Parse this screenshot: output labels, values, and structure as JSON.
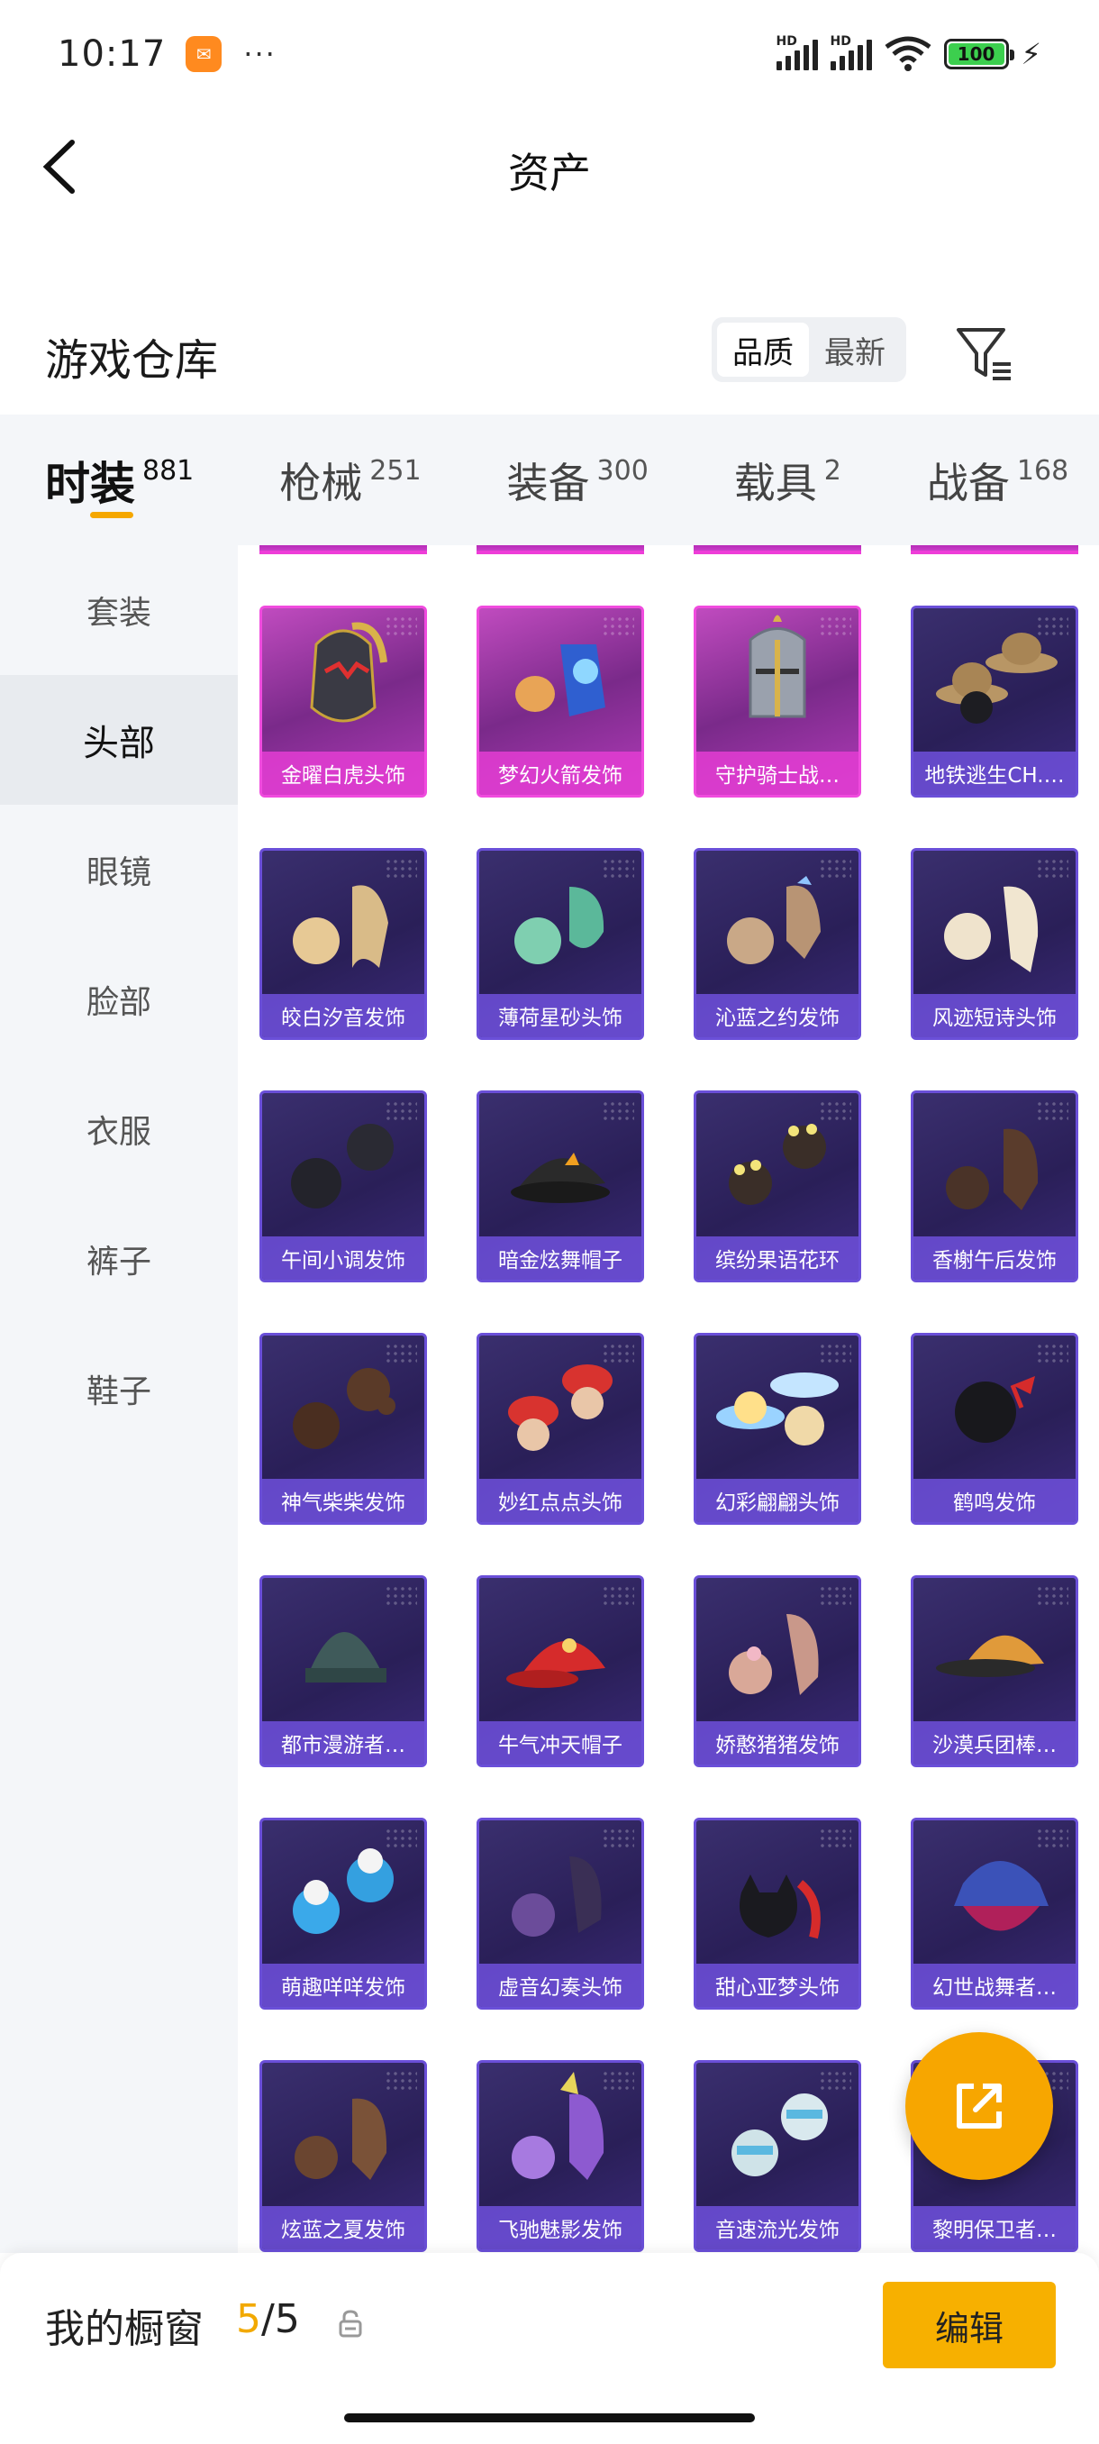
{
  "status_bar": {
    "time": "10:17",
    "dots": "···",
    "network_label": "HD",
    "battery": "100",
    "icons": [
      "app-notification-icon",
      "signal-icon",
      "wifi-icon",
      "battery-icon",
      "charging-icon"
    ]
  },
  "header": {
    "title": "资产",
    "back_icon": "back-arrow-icon"
  },
  "section": {
    "title": "游戏仓库",
    "sort_options": [
      "品质",
      "最新"
    ],
    "sort_selected": "品质",
    "filter_icon": "filter-icon"
  },
  "tabs": [
    {
      "label": "时装",
      "count": "881",
      "active": true
    },
    {
      "label": "枪械",
      "count": "251",
      "active": false
    },
    {
      "label": "装备",
      "count": "300",
      "active": false
    },
    {
      "label": "载具",
      "count": "2",
      "active": false
    },
    {
      "label": "战备",
      "count": "168",
      "active": false
    }
  ],
  "side_menu": [
    {
      "label": "套装",
      "active": false
    },
    {
      "label": "头部",
      "active": true
    },
    {
      "label": "眼镜",
      "active": false
    },
    {
      "label": "脸部",
      "active": false
    },
    {
      "label": "衣服",
      "active": false
    },
    {
      "label": "裤子",
      "active": false
    },
    {
      "label": "鞋子",
      "active": false
    }
  ],
  "items": [
    {
      "name": "金曜白虎头饰",
      "rarity": "legendary",
      "art": "helmet-tiger"
    },
    {
      "name": "梦幻火箭发饰",
      "rarity": "legendary",
      "art": "rocket"
    },
    {
      "name": "守护骑士战…",
      "rarity": "legendary",
      "art": "knight-helmet"
    },
    {
      "name": "地铁逃生CH.…",
      "rarity": "epic",
      "art": "hat-brown"
    },
    {
      "name": "皎白汐音发饰",
      "rarity": "epic",
      "art": "hair-blonde"
    },
    {
      "name": "薄荷星砂头饰",
      "rarity": "epic",
      "art": "hair-mint"
    },
    {
      "name": "沁蓝之约发饰",
      "rarity": "epic",
      "art": "hair-light"
    },
    {
      "name": "风迹短诗头饰",
      "rarity": "epic",
      "art": "hair-cream"
    },
    {
      "name": "午间小调发饰",
      "rarity": "epic",
      "art": "hair-dark"
    },
    {
      "name": "暗金炫舞帽子",
      "rarity": "epic",
      "art": "cap-black"
    },
    {
      "name": "缤纷果语花环",
      "rarity": "epic",
      "art": "flower-crown"
    },
    {
      "name": "香榭午后发饰",
      "rarity": "epic",
      "art": "hair-brown"
    },
    {
      "name": "神气柴柴发饰",
      "rarity": "epic",
      "art": "hair-bun"
    },
    {
      "name": "妙红点点头饰",
      "rarity": "epic",
      "art": "mushroom"
    },
    {
      "name": "幻彩翩翩头饰",
      "rarity": "epic",
      "art": "hat-pastel"
    },
    {
      "name": "鹤鸣发饰",
      "rarity": "epic",
      "art": "hair-ribbon"
    },
    {
      "name": "都市漫游者…",
      "rarity": "epic",
      "art": "beanie"
    },
    {
      "name": "牛气冲天帽子",
      "rarity": "epic",
      "art": "cap-red"
    },
    {
      "name": "娇憨猪猪发饰",
      "rarity": "epic",
      "art": "pig-hair"
    },
    {
      "name": "沙漠兵团棒…",
      "rarity": "epic",
      "art": "cap-desert"
    },
    {
      "name": "萌趣咩咩发饰",
      "rarity": "epic",
      "art": "hair-sheep"
    },
    {
      "name": "虚音幻奏头饰",
      "rarity": "epic",
      "art": "hair-purple"
    },
    {
      "name": "甜心亚梦头饰",
      "rarity": "epic",
      "art": "cat-hair"
    },
    {
      "name": "幻世战舞者…",
      "rarity": "epic",
      "art": "bucket-hat"
    },
    {
      "name": "炫蓝之夏发饰",
      "rarity": "epic",
      "art": "hair-auburn"
    },
    {
      "name": "飞驰魅影发饰",
      "rarity": "epic",
      "art": "hair-violet"
    },
    {
      "name": "音速流光发饰",
      "rarity": "epic",
      "art": "helmet-silver"
    },
    {
      "name": "黎明保卫者…",
      "rarity": "epic",
      "art": "hair-green"
    }
  ],
  "fab": {
    "icon": "share-external-icon"
  },
  "bottom_bar": {
    "showcase_label": "我的橱窗",
    "showcase_current": "5",
    "showcase_total": "/5",
    "lock_icon": "lock-icon",
    "edit_label": "编辑"
  },
  "colors": {
    "accent": "#f7b000",
    "epic_border": "#6a4fd8",
    "legendary_border": "#f04bde"
  }
}
